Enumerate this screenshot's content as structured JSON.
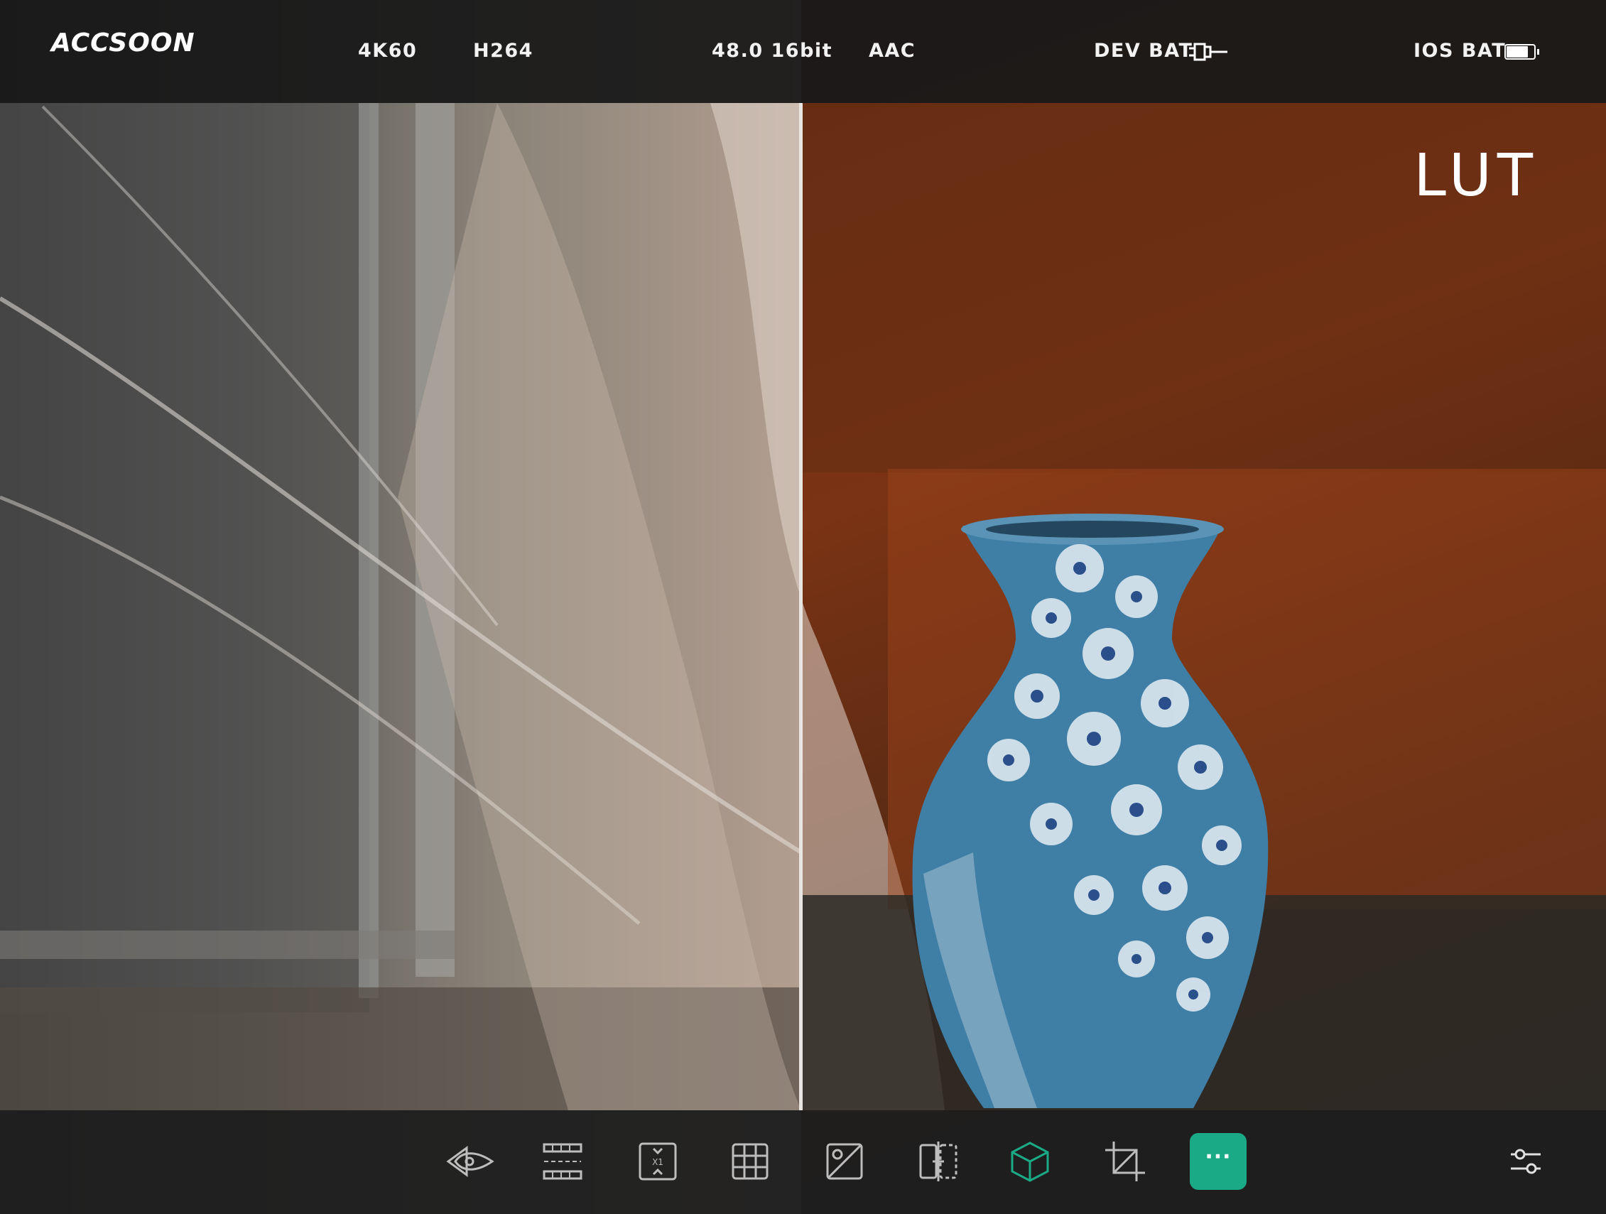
{
  "status_bar": {
    "brand": "ACCSOON",
    "resolution": "4K60",
    "codec": "H264",
    "audio_rate": "48.0 16bit",
    "audio_codec": "AAC",
    "dev_bat_label": "DEV BAT",
    "ios_bat_label": "IOS BAT",
    "ios_bat_level": 0.8
  },
  "overlay": {
    "mode_label": "LUT"
  },
  "toolbar": {
    "tools": [
      {
        "name": "focus-peaking",
        "icon": "diamond-eye-icon"
      },
      {
        "name": "false-color",
        "icon": "stripes-icon"
      },
      {
        "name": "desqueeze",
        "icon": "desqueeze-x1-icon",
        "label": "X1"
      },
      {
        "name": "grid",
        "icon": "grid-icon"
      },
      {
        "name": "exposure",
        "icon": "exposure-icon"
      },
      {
        "name": "split-compare",
        "icon": "split-view-icon"
      },
      {
        "name": "lut",
        "icon": "cube-icon",
        "active": true
      },
      {
        "name": "crop",
        "icon": "crop-icon"
      },
      {
        "name": "more",
        "icon": "more-icon",
        "label": "···"
      }
    ],
    "settings_icon": "sliders-icon"
  },
  "colors": {
    "accent": "#1aaa86",
    "bar_bg": "#181818",
    "text": "#ffffff"
  }
}
